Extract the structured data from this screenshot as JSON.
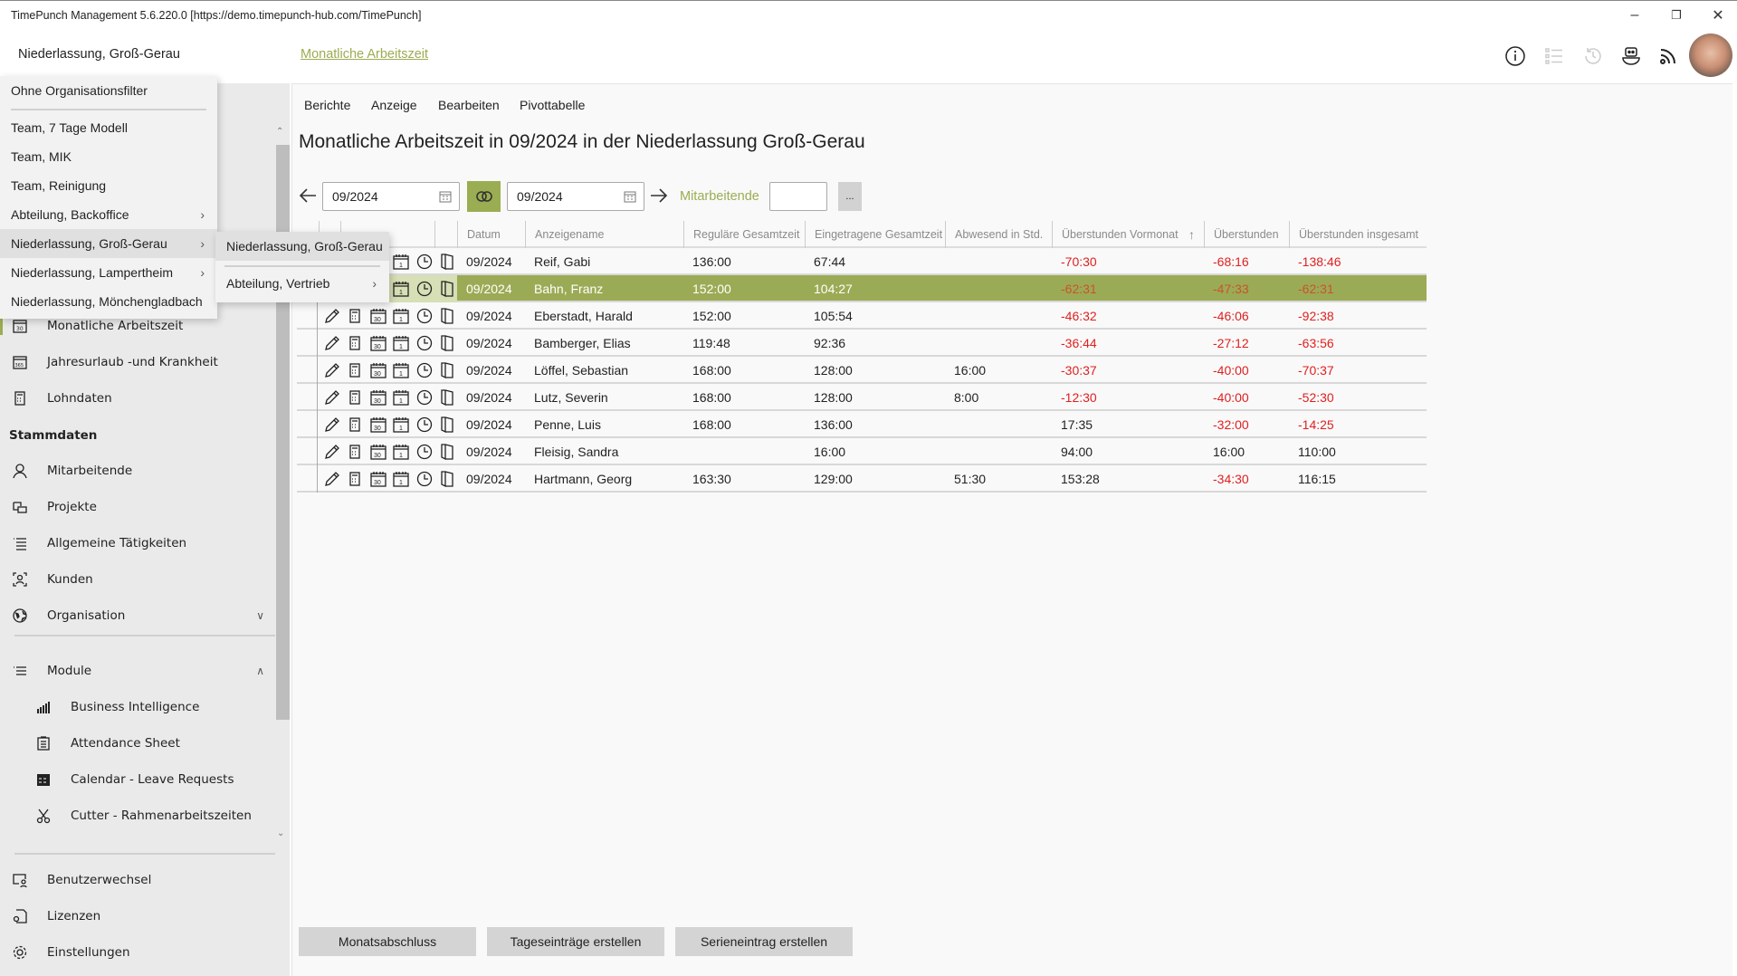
{
  "window": {
    "title": "TimePunch Management 5.6.220.0 [https://demo.timepunch-hub.com/TimePunch]"
  },
  "header": {
    "org": "Niederlassung,  Groß-Gerau",
    "breadcrumb": "Monatliche Arbeitszeit",
    "icons": [
      "info-icon",
      "list-icon",
      "history-icon",
      "bot-icon",
      "feed-icon"
    ]
  },
  "org_menu": {
    "items": [
      {
        "label": "Ohne Organisationsfilter",
        "submenu": false
      },
      {
        "label": "Team,  7 Tage Modell",
        "submenu": false
      },
      {
        "label": "Team,  MIK",
        "submenu": false
      },
      {
        "label": "Team,  Reinigung",
        "submenu": false
      },
      {
        "label": "Abteilung,  Backoffice",
        "submenu": true
      },
      {
        "label": "Niederlassung,  Groß-Gerau",
        "submenu": true,
        "highlighted": true
      },
      {
        "label": "Niederlassung,  Lampertheim",
        "submenu": true
      },
      {
        "label": "Niederlassung,  Mönchengladbach",
        "submenu": false
      }
    ],
    "submenu": [
      {
        "label": "Niederlassung,  Groß-Gerau"
      },
      {
        "label": "Abteilung,  Vertrieb",
        "submenu": true
      }
    ]
  },
  "sidebar": {
    "items": [
      {
        "label": "Monatliche Arbeitszeit",
        "icon": "calendar-30-icon",
        "active": true
      },
      {
        "label": "Jahresurlaub -und Krankheit",
        "icon": "calendar-365-icon"
      },
      {
        "label": "Lohndaten",
        "icon": "calculator-icon"
      }
    ],
    "stammdaten_title": "Stammdaten",
    "stammdaten": [
      {
        "label": "Mitarbeitende",
        "icon": "person-icon"
      },
      {
        "label": "Projekte",
        "icon": "projects-icon"
      },
      {
        "label": "Allgemeine Tätigkeiten",
        "icon": "list-icon"
      },
      {
        "label": "Kunden",
        "icon": "customer-icon"
      },
      {
        "label": "Organisation",
        "icon": "globe-icon",
        "chevron": "down"
      }
    ],
    "module": {
      "label": "Module",
      "icon": "module-icon",
      "items": [
        {
          "label": "Business Intelligence",
          "icon": "bar-chart-icon"
        },
        {
          "label": "Attendance Sheet",
          "icon": "sheet-icon"
        },
        {
          "label": "Calendar - Leave Requests",
          "icon": "calendar-icon"
        },
        {
          "label": "Cutter - Rahmenarbeitszeiten",
          "icon": "scissors-icon"
        }
      ]
    },
    "bottom": [
      {
        "label": "Benutzerwechsel",
        "icon": "switch-user-icon"
      },
      {
        "label": "Lizenzen",
        "icon": "license-icon"
      },
      {
        "label": "Einstellungen",
        "icon": "gear-icon"
      }
    ]
  },
  "menu": [
    "Berichte",
    "Anzeige",
    "Bearbeiten",
    "Pivottabelle"
  ],
  "page_title": "Monatliche Arbeitszeit in 09/2024 in der Niederlassung Groß-Gerau",
  "filter": {
    "from": "09/2024",
    "to": "09/2024",
    "employees_label": "Mitarbeitende",
    "employees_value": "",
    "more": "..."
  },
  "table": {
    "columns": [
      "Datum",
      "Anzeigename",
      "Reguläre Gesamtzeit",
      "Eingetragene Gesamtzeit",
      "Abwesend in Std.",
      "Überstunden Vormonat",
      "Überstunden",
      "Überstunden insgesamt"
    ],
    "sort": {
      "column": "Überstunden Vormonat",
      "direction": "asc"
    },
    "rows": [
      [
        "09/2024",
        "Reif, Gabi",
        "136:00",
        "67:44",
        "",
        "-70:30",
        "-68:16",
        "-138:46"
      ],
      [
        "09/2024",
        "Bahn, Franz",
        "152:00",
        "104:27",
        "",
        "-62:31",
        "-47:33",
        "-62:31"
      ],
      [
        "09/2024",
        "Eberstadt, Harald",
        "152:00",
        "105:54",
        "",
        "-46:32",
        "-46:06",
        "-92:38"
      ],
      [
        "09/2024",
        "Bamberger, Elias",
        "119:48",
        "92:36",
        "",
        "-36:44",
        "-27:12",
        "-63:56"
      ],
      [
        "09/2024",
        "Löffel, Sebastian",
        "168:00",
        "128:00",
        "16:00",
        "-30:37",
        "-40:00",
        "-70:37"
      ],
      [
        "09/2024",
        "Lutz, Severin",
        "168:00",
        "128:00",
        "8:00",
        "-12:30",
        "-40:00",
        "-52:30"
      ],
      [
        "09/2024",
        "Penne, Luis",
        "168:00",
        "136:00",
        "",
        "17:35",
        "-32:00",
        "-14:25"
      ],
      [
        "09/2024",
        "Fleisig, Sandra",
        "",
        "16:00",
        "",
        "94:00",
        "16:00",
        "110:00"
      ],
      [
        "09/2024",
        "Hartmann, Georg",
        "163:30",
        "129:00",
        "51:30",
        "153:28",
        "-34:30",
        "116:15"
      ]
    ],
    "selected_row": 1
  },
  "buttons": [
    "Monatsabschluss",
    "Tageseinträge erstellen",
    "Serieneintrag erstellen"
  ],
  "colors": {
    "accent": "#9aad52",
    "negative": "#e02020",
    "selected": "#9bab55"
  }
}
